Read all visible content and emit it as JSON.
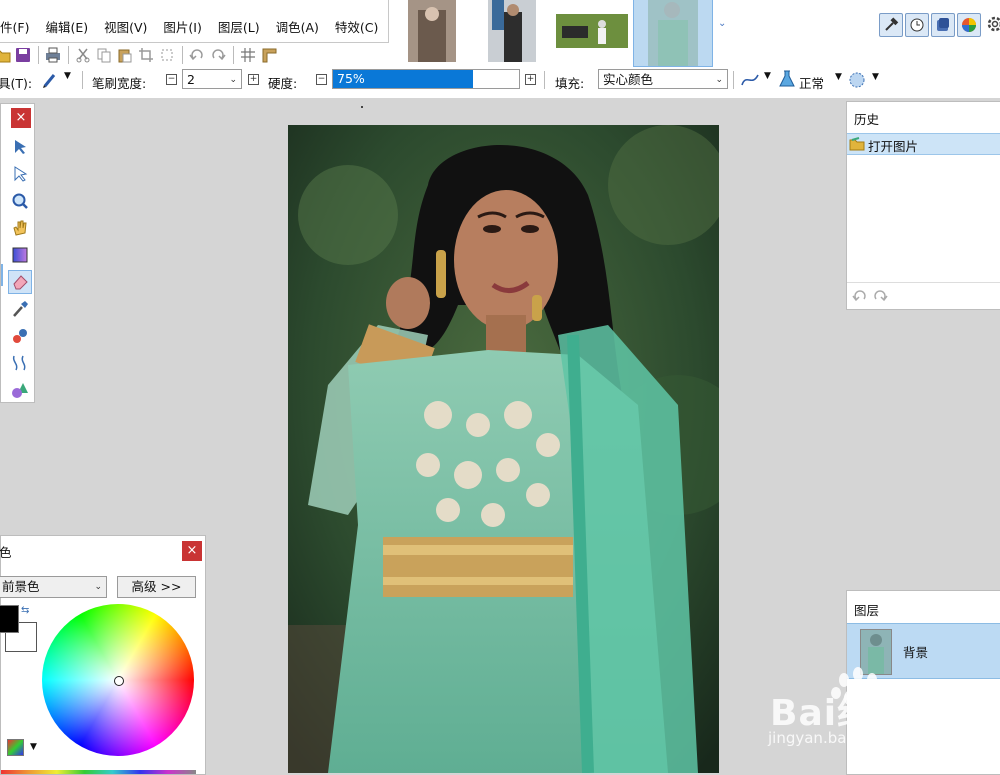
{
  "menu": {
    "items": [
      "件(F)",
      "编辑(E)",
      "视图(V)",
      "图片(I)",
      "图层(L)",
      "调色(A)",
      "特效(C)"
    ]
  },
  "options": {
    "tool_label": "具(T):",
    "brush_width_label": "笔刷宽度:",
    "brush_width_value": "2",
    "hardness_label": "硬度:",
    "hardness_value": "75%",
    "hardness_fraction": 0.75,
    "fill_label": "填充:",
    "fill_value": "实心颜色",
    "blend_mode": "正常"
  },
  "tools_panel": {
    "close": "×"
  },
  "colors_panel": {
    "title": "色",
    "select_value": "前景色",
    "advanced_button": "高级 >>",
    "close": "×",
    "primary_color": "#000000",
    "secondary_color": "#ffffff"
  },
  "history_panel": {
    "title": "历史",
    "items": [
      "打开图片"
    ]
  },
  "layers_panel": {
    "title": "图层",
    "layers": [
      "背景"
    ]
  },
  "watermark": {
    "brand": "Bai经验",
    "url": "jingyan.baidu.com"
  },
  "colors": {
    "accent": "#0a78d7",
    "selection": "#cde4f7",
    "close_red": "#c93434"
  }
}
